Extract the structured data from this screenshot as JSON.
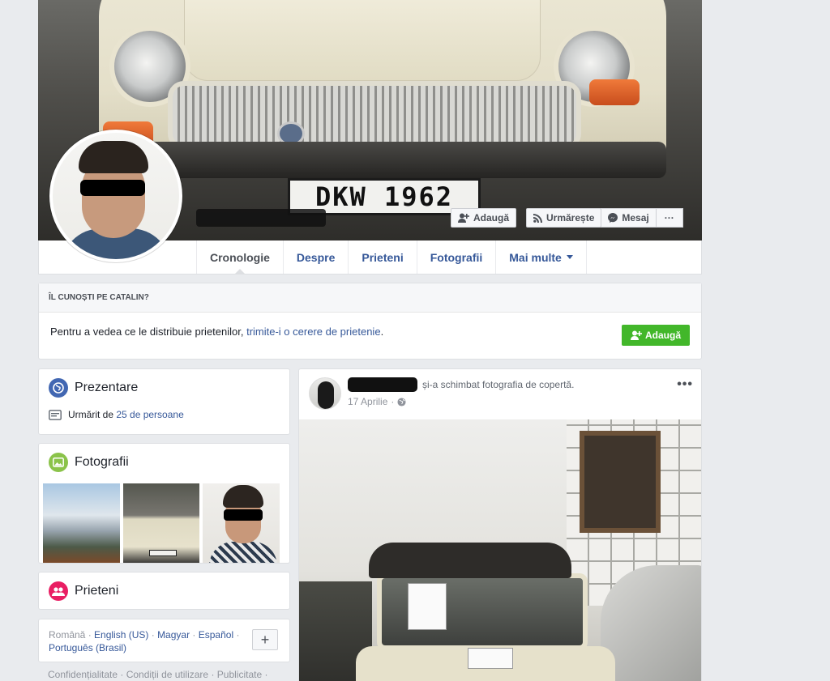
{
  "cover": {
    "plate_text": "DKW 1962",
    "buttons": {
      "add": "Adaugă",
      "follow": "Urmărește",
      "message": "Mesaj",
      "more": "···"
    }
  },
  "nav": {
    "tabs": [
      "Cronologie",
      "Despre",
      "Prieteni",
      "Fotografii",
      "Mai multe"
    ],
    "active": "Cronologie"
  },
  "know": {
    "title": "ÎL CUNOȘTI PE CATALIN?",
    "text_prefix": "Pentru a vedea ce le distribuie prietenilor, ",
    "link": "trimite-i o cerere de prietenie",
    "text_suffix": ".",
    "button": "Adaugă"
  },
  "intro": {
    "title": "Prezentare",
    "followed_prefix": "Urmărit de ",
    "followed_link": "25 de persoane"
  },
  "photos": {
    "title": "Fotografii"
  },
  "friends": {
    "title": "Prieteni"
  },
  "languages": {
    "current": "Română",
    "links": [
      "English (US)",
      "Magyar",
      "Español",
      "Português (Brasil)"
    ],
    "add_button": "+"
  },
  "footer": {
    "links": "Confidențialitate · Condiții de utilizare · Publicitate ·"
  },
  "post": {
    "action": "și-a schimbat fotografia de copertă.",
    "date": "17 Aprilie",
    "separator": "·",
    "more": "•••"
  },
  "colors": {
    "link": "#365899",
    "green": "#42b72a",
    "intro_icon": "#4267b2",
    "photos_icon": "#8bc34a",
    "friends_icon": "#e91e63"
  }
}
